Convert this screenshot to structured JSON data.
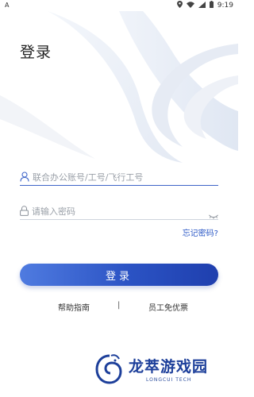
{
  "status_bar": {
    "left_indicator": "A",
    "time": "9:19"
  },
  "login": {
    "title": "登录",
    "account_placeholder": "联合办公账号/工号/飞行工号",
    "password_placeholder": "请输入密码",
    "forgot_label": "忘记密码?",
    "submit_label": "登录"
  },
  "footer_links": {
    "help_label": "帮助指南",
    "separator": "|",
    "promo_label": "员工免优票"
  },
  "watermark": {
    "brand_text": "龙萃游戏园",
    "sub_text": "LONGCUI TECH"
  },
  "colors": {
    "accent": "#2b53c4",
    "brand": "#1d3f9a"
  }
}
